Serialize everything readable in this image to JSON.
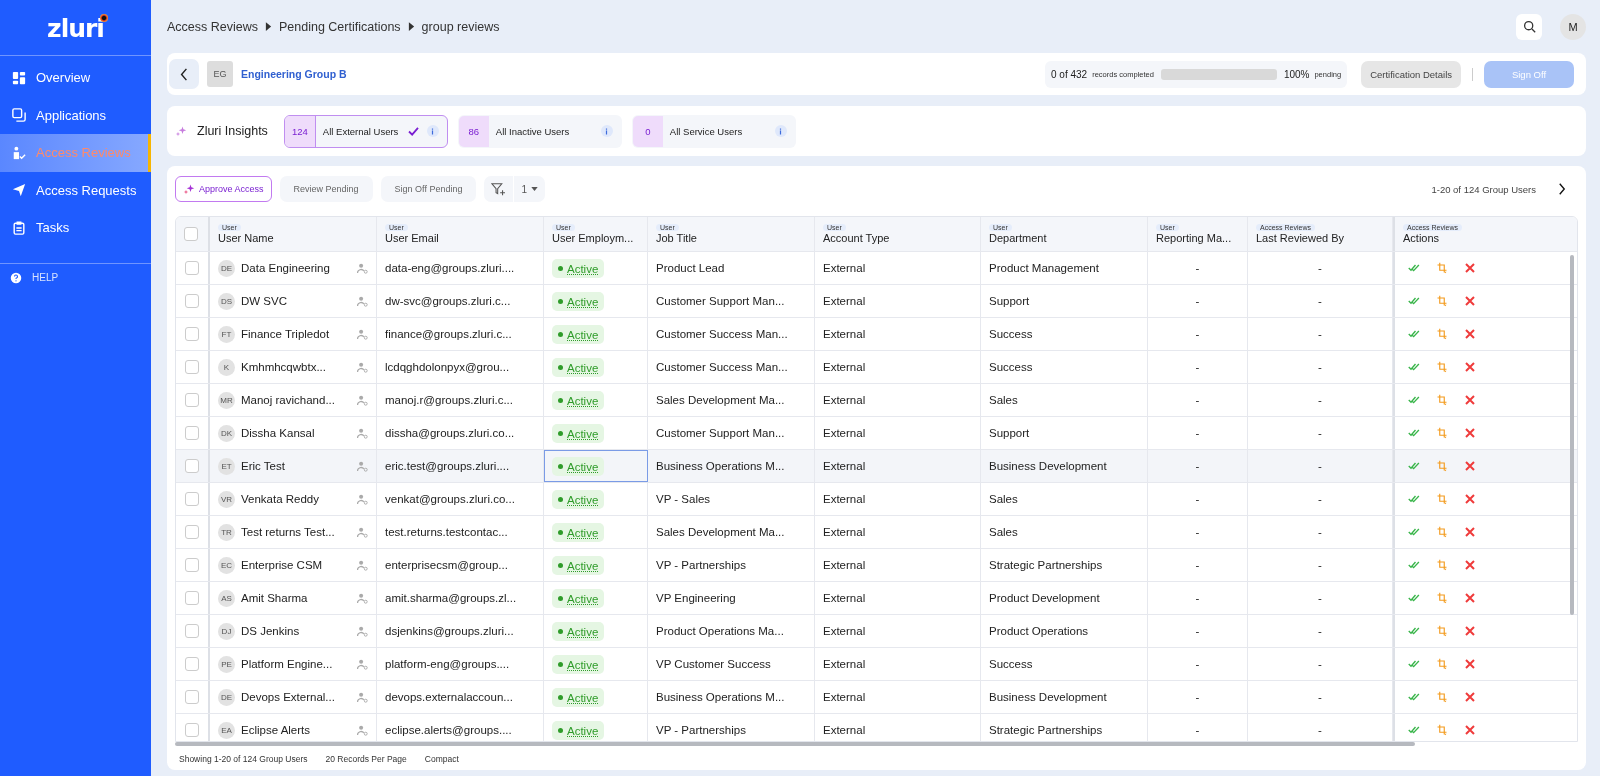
{
  "logo": "zluri",
  "sidebar": {
    "items": [
      {
        "label": "Overview",
        "selected": false
      },
      {
        "label": "Applications",
        "selected": false
      },
      {
        "label": "Access Reviews",
        "selected": true
      },
      {
        "label": "Access Requests",
        "selected": false
      },
      {
        "label": "Tasks",
        "selected": false
      }
    ],
    "help": "HELP"
  },
  "breadcrumbs": [
    "Access Reviews",
    "Pending Certifications",
    "group reviews"
  ],
  "user_avatar": "M",
  "group": {
    "initials": "EG",
    "name": "Engineering Group B"
  },
  "progress": {
    "count": "0 of 432",
    "label": "records completed",
    "level": 0,
    "percent": "100%",
    "status": "pending"
  },
  "header_buttons": {
    "details": "Certification Details",
    "sign_off": "Sign Off"
  },
  "insights": {
    "title": "Zluri Insights",
    "chips": [
      {
        "count": "124",
        "label": "All External Users",
        "selected": true
      },
      {
        "count": "86",
        "label": "All Inactive Users",
        "selected": false
      },
      {
        "count": "0",
        "label": "All Service Users",
        "selected": false
      }
    ]
  },
  "toolbar": {
    "approve": "Approve Access",
    "review_pending": "Review Pending",
    "sign_off_pending": "Sign Off Pending",
    "filter_count": "1",
    "range": "1-20 of 124 Group Users"
  },
  "table": {
    "select_all_checked": false,
    "columns": [
      {
        "group": "User",
        "label": "User Name"
      },
      {
        "group": "User",
        "label": "User Email"
      },
      {
        "group": "User",
        "label": "User Employm..."
      },
      {
        "group": "User",
        "label": "Job Title"
      },
      {
        "group": "User",
        "label": "Account Type"
      },
      {
        "group": "User",
        "label": "Department"
      },
      {
        "group": "User",
        "label": "Reporting Ma..."
      },
      {
        "group": "Access Reviews",
        "label": "Last Reviewed By"
      },
      {
        "group": "Access Reviews",
        "label": "Actions"
      }
    ],
    "rows": [
      {
        "initials": "DE",
        "name": "Data Engineering",
        "email": "data-eng@groups.zluri....",
        "status": "Active",
        "job": "Product Lead",
        "account": "External",
        "department": "Product Management",
        "manager": "-",
        "reviewer": "-",
        "selected": false
      },
      {
        "initials": "DS",
        "name": "DW SVC",
        "email": "dw-svc@groups.zluri.c...",
        "status": "Active",
        "job": "Customer Support Man...",
        "account": "External",
        "department": "Support",
        "manager": "-",
        "reviewer": "-",
        "selected": false
      },
      {
        "initials": "FT",
        "name": "Finance Tripledot",
        "email": "finance@groups.zluri.c...",
        "status": "Active",
        "job": "Customer Success Man...",
        "account": "External",
        "department": "Success",
        "manager": "-",
        "reviewer": "-",
        "selected": false
      },
      {
        "initials": "K",
        "name": "Kmhmhcqwbtx...",
        "email": "lcdqghdolonpyx@grou...",
        "status": "Active",
        "job": "Customer Success Man...",
        "account": "External",
        "department": "Success",
        "manager": "-",
        "reviewer": "-",
        "selected": false
      },
      {
        "initials": "MR",
        "name": "Manoj ravichand...",
        "email": "manoj.r@groups.zluri.c...",
        "status": "Active",
        "job": "Sales Development Ma...",
        "account": "External",
        "department": "Sales",
        "manager": "-",
        "reviewer": "-",
        "selected": false
      },
      {
        "initials": "DK",
        "name": "Dissha Kansal",
        "email": "dissha@groups.zluri.co...",
        "status": "Active",
        "job": "Customer Support Man...",
        "account": "External",
        "department": "Support",
        "manager": "-",
        "reviewer": "-",
        "selected": false
      },
      {
        "initials": "ET",
        "name": "Eric Test",
        "email": "eric.test@groups.zluri....",
        "status": "Active",
        "job": "Business Operations M...",
        "account": "External",
        "department": "Business Development",
        "manager": "-",
        "reviewer": "-",
        "selected": true
      },
      {
        "initials": "VR",
        "name": "Venkata Reddy",
        "email": "venkat@groups.zluri.co...",
        "status": "Active",
        "job": "VP - Sales",
        "account": "External",
        "department": "Sales",
        "manager": "-",
        "reviewer": "-",
        "selected": false
      },
      {
        "initials": "TR",
        "name": "Test returns Test...",
        "email": "test.returns.testcontac...",
        "status": "Active",
        "job": "Sales Development Ma...",
        "account": "External",
        "department": "Sales",
        "manager": "-",
        "reviewer": "-",
        "selected": false
      },
      {
        "initials": "EC",
        "name": "Enterprise CSM",
        "email": "enterprisecsm@group...",
        "status": "Active",
        "job": "VP - Partnerships",
        "account": "External",
        "department": "Strategic Partnerships",
        "manager": "-",
        "reviewer": "-",
        "selected": false
      },
      {
        "initials": "AS",
        "name": "Amit Sharma",
        "email": "amit.sharma@groups.zl...",
        "status": "Active",
        "job": "VP Engineering",
        "account": "External",
        "department": "Product Development",
        "manager": "-",
        "reviewer": "-",
        "selected": false
      },
      {
        "initials": "DJ",
        "name": "DS Jenkins",
        "email": "dsjenkins@groups.zluri...",
        "status": "Active",
        "job": "Product Operations Ma...",
        "account": "External",
        "department": "Product Operations",
        "manager": "-",
        "reviewer": "-",
        "selected": false
      },
      {
        "initials": "PE",
        "name": "Platform Engine...",
        "email": "platform-eng@groups....",
        "status": "Active",
        "job": "VP Customer Success",
        "account": "External",
        "department": "Success",
        "manager": "-",
        "reviewer": "-",
        "selected": false
      },
      {
        "initials": "DE",
        "name": "Devops External...",
        "email": "devops.externalaccoun...",
        "status": "Active",
        "job": "Business Operations M...",
        "account": "External",
        "department": "Business Development",
        "manager": "-",
        "reviewer": "-",
        "selected": false
      },
      {
        "initials": "EA",
        "name": "Eclipse Alerts",
        "email": "eclipse.alerts@groups....",
        "status": "Active",
        "job": "VP - Partnerships",
        "account": "External",
        "department": "Strategic Partnerships",
        "manager": "-",
        "reviewer": "-",
        "selected": false
      }
    ]
  },
  "footer": {
    "showing": "Showing 1-20 of 124 Group Users",
    "per_page": "20 Records Per Page",
    "density": "Compact"
  }
}
